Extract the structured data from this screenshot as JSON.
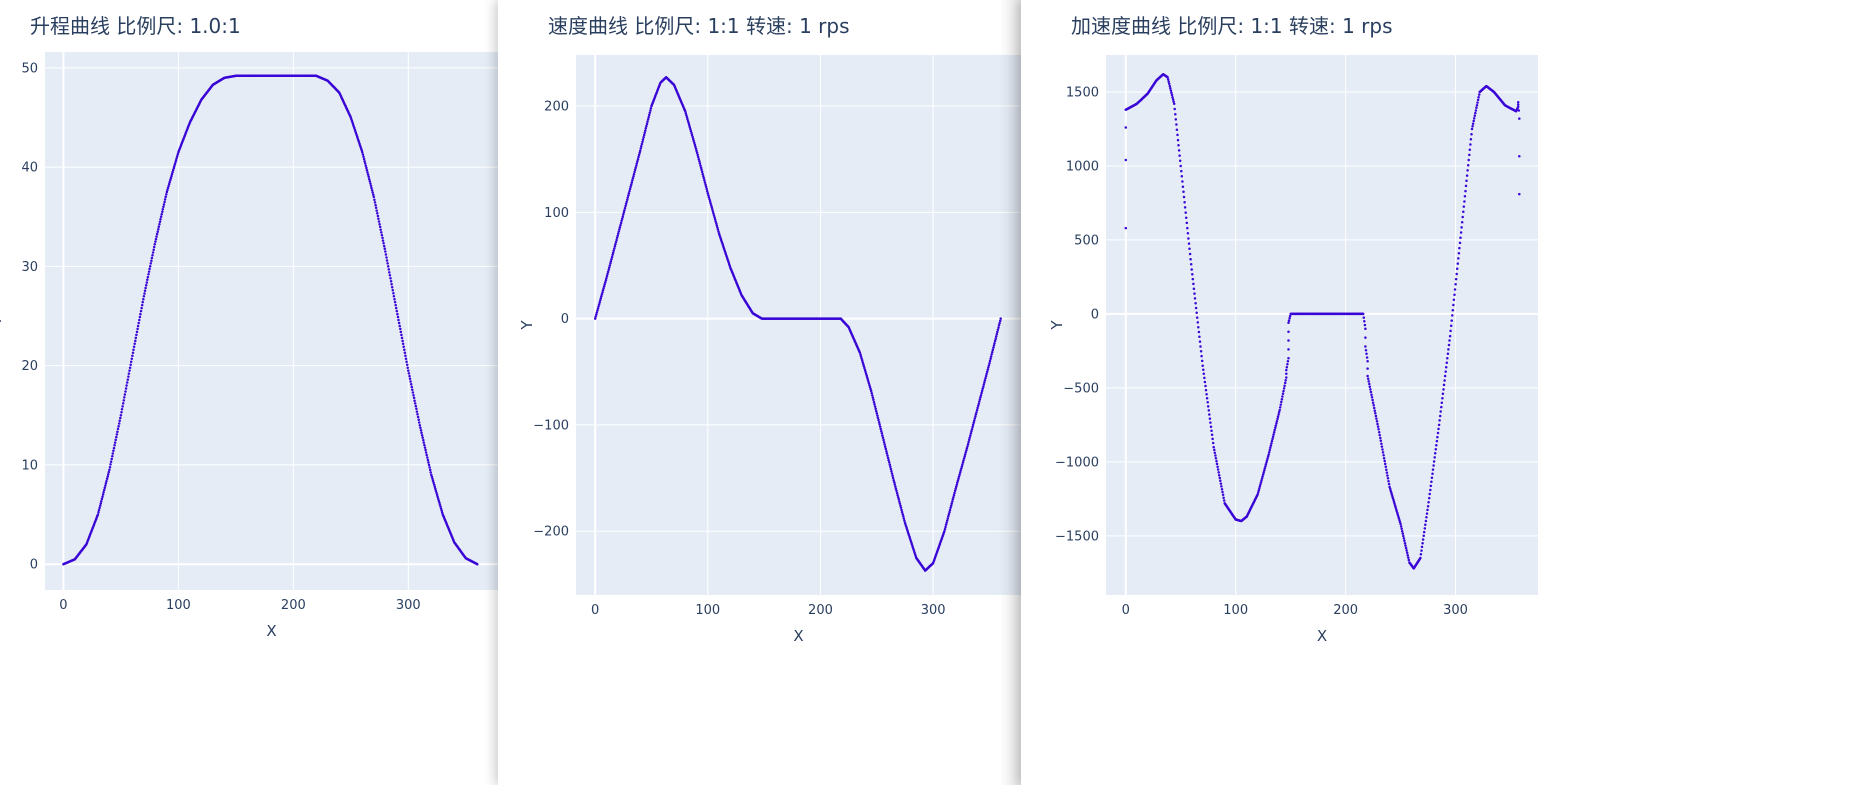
{
  "colors": {
    "plot_bg": "#e5ecf6",
    "grid": "#ffffff",
    "line": "#3a06d6",
    "text": "#2a3f5f"
  },
  "chart_data": [
    {
      "type": "scatter",
      "title": "升程曲线 比例尺: 1.0:1",
      "xlabel": "X",
      "ylabel": "Y",
      "xlim": [
        -16,
        378
      ],
      "ylim": [
        -2.6,
        51.6
      ],
      "xticks": [
        0,
        100,
        200,
        300
      ],
      "yticks": [
        0,
        10,
        20,
        30,
        40,
        50
      ],
      "grid": true,
      "series": [
        {
          "points": [
            [
              0,
              0
            ],
            [
              10,
              0.5
            ],
            [
              20,
              2
            ],
            [
              30,
              5
            ],
            [
              40,
              9.5
            ],
            [
              50,
              15
            ],
            [
              60,
              21
            ],
            [
              70,
              27
            ],
            [
              80,
              32.5
            ],
            [
              90,
              37.5
            ],
            [
              100,
              41.5
            ],
            [
              110,
              44.5
            ],
            [
              120,
              46.8
            ],
            [
              130,
              48.3
            ],
            [
              140,
              49
            ],
            [
              150,
              49.2
            ],
            [
              220,
              49.2
            ],
            [
              230,
              48.7
            ],
            [
              240,
              47.5
            ],
            [
              250,
              45
            ],
            [
              260,
              41.5
            ],
            [
              270,
              37
            ],
            [
              280,
              31.5
            ],
            [
              290,
              25.5
            ],
            [
              300,
              19.5
            ],
            [
              310,
              14
            ],
            [
              320,
              9
            ],
            [
              330,
              5
            ],
            [
              340,
              2.2
            ],
            [
              350,
              0.6
            ],
            [
              360,
              0
            ]
          ]
        }
      ]
    },
    {
      "type": "scatter",
      "title": "速度曲线 比例尺: 1:1 转速: 1 rps",
      "xlabel": "X",
      "ylabel": "Y",
      "xlim": [
        -17,
        378
      ],
      "ylim": [
        -260,
        248
      ],
      "xticks": [
        0,
        100,
        200,
        300
      ],
      "yticks": [
        -200,
        -100,
        0,
        100,
        200
      ],
      "grid": true,
      "series": [
        {
          "points": [
            [
              0,
              0
            ],
            [
              10,
              38
            ],
            [
              20,
              78
            ],
            [
              30,
              118
            ],
            [
              40,
              158
            ],
            [
              50,
              200
            ],
            [
              58,
              222
            ],
            [
              63,
              227
            ],
            [
              70,
              220
            ],
            [
              80,
              195
            ],
            [
              90,
              158
            ],
            [
              100,
              118
            ],
            [
              110,
              80
            ],
            [
              120,
              48
            ],
            [
              130,
              22
            ],
            [
              140,
              5
            ],
            [
              148,
              0
            ],
            [
              218,
              0
            ],
            [
              225,
              -8
            ],
            [
              235,
              -32
            ],
            [
              245,
              -68
            ],
            [
              255,
              -110
            ],
            [
              265,
              -152
            ],
            [
              275,
              -192
            ],
            [
              285,
              -225
            ],
            [
              293,
              -237
            ],
            [
              300,
              -230
            ],
            [
              310,
              -200
            ],
            [
              320,
              -160
            ],
            [
              330,
              -122
            ],
            [
              340,
              -82
            ],
            [
              350,
              -42
            ],
            [
              360,
              0
            ]
          ]
        }
      ]
    },
    {
      "type": "scatter",
      "title": "加速度曲线 比例尺: 1:1 转速: 1 rps",
      "xlabel": "X",
      "ylabel": "Y",
      "xlim": [
        -18,
        375
      ],
      "ylim": [
        -1900,
        1750
      ],
      "xticks": [
        0,
        100,
        200,
        300
      ],
      "yticks": [
        -1500,
        -1000,
        -500,
        0,
        500,
        1000,
        1500
      ],
      "grid": true,
      "series": [
        {
          "points": [
            [
              0,
              1380
            ],
            [
              10,
              1420
            ],
            [
              20,
              1490
            ],
            [
              28,
              1580
            ],
            [
              34,
              1620
            ],
            [
              38,
              1600
            ],
            [
              44,
              1420
            ],
            [
              50,
              1000
            ],
            [
              60,
              300
            ],
            [
              70,
              -350
            ],
            [
              80,
              -900
            ],
            [
              90,
              -1280
            ],
            [
              100,
              -1390
            ],
            [
              105,
              -1400
            ],
            [
              110,
              -1370
            ],
            [
              120,
              -1220
            ],
            [
              130,
              -950
            ],
            [
              140,
              -650
            ],
            [
              146,
              -430
            ],
            [
              146,
              -380
            ],
            [
              148,
              -300
            ],
            [
              148,
              -180
            ],
            [
              148,
              -60
            ],
            [
              150,
              0
            ],
            [
              216,
              0
            ],
            [
              218,
              -100
            ],
            [
              218,
              -220
            ],
            [
              220,
              -320
            ],
            [
              220,
              -420
            ],
            [
              230,
              -780
            ],
            [
              240,
              -1170
            ],
            [
              250,
              -1420
            ],
            [
              258,
              -1680
            ],
            [
              262,
              -1720
            ],
            [
              268,
              -1650
            ],
            [
              275,
              -1300
            ],
            [
              285,
              -750
            ],
            [
              295,
              -150
            ],
            [
              305,
              550
            ],
            [
              315,
              1250
            ],
            [
              322,
              1500
            ],
            [
              328,
              1540
            ],
            [
              335,
              1500
            ],
            [
              345,
              1410
            ],
            [
              355,
              1370
            ],
            [
              357,
              1400
            ],
            [
              357,
              1430
            ],
            [
              358,
              1320
            ],
            [
              358,
              810
            ]
          ]
        },
        {
          "points": [
            [
              0,
              580
            ],
            [
              0,
              1040
            ],
            [
              0,
              1260
            ]
          ]
        }
      ]
    }
  ]
}
